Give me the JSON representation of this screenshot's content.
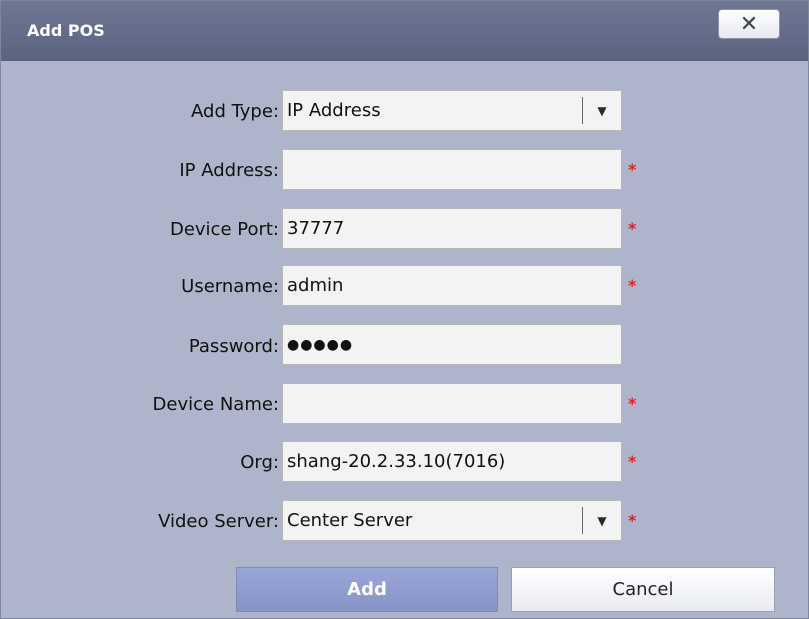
{
  "dialog": {
    "title": "Add POS",
    "close_glyph": "✕"
  },
  "form": {
    "add_type": {
      "label": "Add Type:",
      "value": "IP Address"
    },
    "ip_address": {
      "label": "IP Address:",
      "value": ""
    },
    "device_port": {
      "label": "Device Port:",
      "value": "37777"
    },
    "username": {
      "label": "Username:",
      "value": "admin"
    },
    "password": {
      "label": "Password:",
      "value": "●●●●●"
    },
    "device_name": {
      "label": "Device Name:",
      "value": ""
    },
    "org": {
      "label": "Org:",
      "value": "shang-20.2.33.10(7016)"
    },
    "video_server": {
      "label": "Video Server:",
      "value": "Center Server"
    },
    "required_mark": "*",
    "dropdown_arrow": "▼"
  },
  "buttons": {
    "add": "Add",
    "cancel": "Cancel"
  },
  "colors": {
    "dialog_bg": "#aeb5ca",
    "titlebar": "#5f6885",
    "required": "#e02222",
    "add_button": "#8f9bcf"
  }
}
